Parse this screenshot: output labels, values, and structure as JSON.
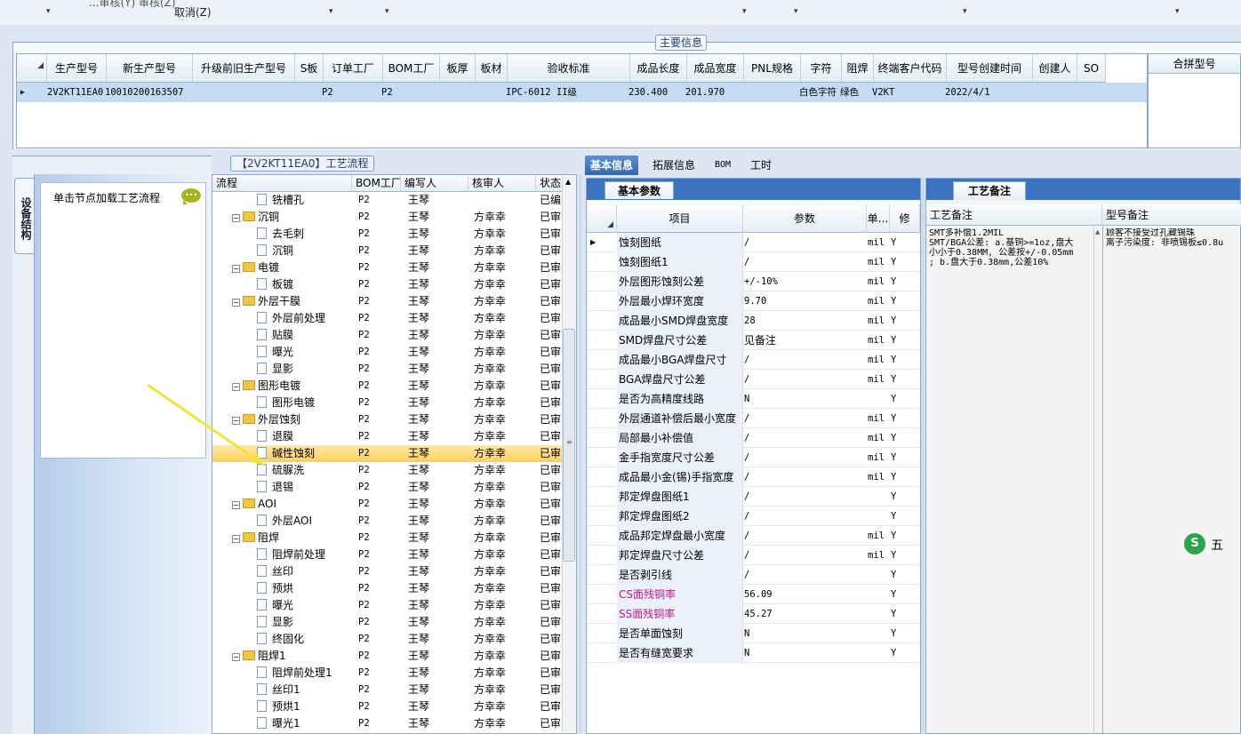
{
  "top": {
    "partial_text": "...审核(Y)   审核(Z)",
    "cancel_label": "取消(Z)"
  },
  "main_info": {
    "title": "主要信息",
    "columns": [
      "生产型号",
      "新生产型号",
      "升级前旧生产型号",
      "S板",
      "订单工厂",
      "BOM工厂",
      "板厚",
      "板材",
      "验收标准",
      "成品长度",
      "成品宽度",
      "PNL规格",
      "字符",
      "阻焊",
      "终端客户代码",
      "型号创建时间",
      "创建人",
      "SO"
    ],
    "row": [
      "2V2KT11EA0",
      "10010200163507",
      "",
      "",
      "P2",
      "P2",
      "",
      "",
      "IPC-6012 II级",
      "230.400",
      "201.970",
      "",
      "白色字符",
      "绿色",
      "V2KT",
      "2022/4/1",
      "",
      ""
    ],
    "merge_header": "合拼型号"
  },
  "left": {
    "side_tab": "设备结构",
    "load_hint": "单击节点加载工艺流程"
  },
  "process": {
    "title": "【2V2KT11EA0】工艺流程",
    "columns": [
      "流程",
      "BOM工厂",
      "编写人",
      "核审人",
      "状态"
    ],
    "rows": [
      {
        "name": "铣槽孔",
        "level": 2,
        "type": "doc",
        "bom": "P2",
        "writer": "王琴",
        "reviewer": "",
        "status": "已编"
      },
      {
        "name": "沉铜",
        "level": 1,
        "type": "folder",
        "bom": "P2",
        "writer": "王琴",
        "reviewer": "方幸幸",
        "status": "已审"
      },
      {
        "name": "去毛刺",
        "level": 2,
        "type": "doc",
        "bom": "P2",
        "writer": "王琴",
        "reviewer": "方幸幸",
        "status": "已审"
      },
      {
        "name": "沉铜",
        "level": 2,
        "type": "doc",
        "bom": "P2",
        "writer": "王琴",
        "reviewer": "方幸幸",
        "status": "已审"
      },
      {
        "name": "电镀",
        "level": 1,
        "type": "folder",
        "bom": "P2",
        "writer": "王琴",
        "reviewer": "方幸幸",
        "status": "已审"
      },
      {
        "name": "板镀",
        "level": 2,
        "type": "doc",
        "bom": "P2",
        "writer": "王琴",
        "reviewer": "方幸幸",
        "status": "已审"
      },
      {
        "name": "外层干膜",
        "level": 1,
        "type": "folder",
        "bom": "P2",
        "writer": "王琴",
        "reviewer": "方幸幸",
        "status": "已审"
      },
      {
        "name": "外层前处理",
        "level": 2,
        "type": "doc",
        "bom": "P2",
        "writer": "王琴",
        "reviewer": "方幸幸",
        "status": "已审"
      },
      {
        "name": "贴膜",
        "level": 2,
        "type": "doc",
        "bom": "P2",
        "writer": "王琴",
        "reviewer": "方幸幸",
        "status": "已审"
      },
      {
        "name": "曝光",
        "level": 2,
        "type": "doc",
        "bom": "P2",
        "writer": "王琴",
        "reviewer": "方幸幸",
        "status": "已审"
      },
      {
        "name": "显影",
        "level": 2,
        "type": "doc",
        "bom": "P2",
        "writer": "王琴",
        "reviewer": "方幸幸",
        "status": "已审"
      },
      {
        "name": "图形电镀",
        "level": 1,
        "type": "folder",
        "bom": "P2",
        "writer": "王琴",
        "reviewer": "方幸幸",
        "status": "已审"
      },
      {
        "name": "图形电镀",
        "level": 2,
        "type": "doc",
        "bom": "P2",
        "writer": "王琴",
        "reviewer": "方幸幸",
        "status": "已审"
      },
      {
        "name": "外层蚀刻",
        "level": 1,
        "type": "folder",
        "bom": "P2",
        "writer": "王琴",
        "reviewer": "方幸幸",
        "status": "已审"
      },
      {
        "name": "退膜",
        "level": 2,
        "type": "doc",
        "bom": "P2",
        "writer": "王琴",
        "reviewer": "方幸幸",
        "status": "已审"
      },
      {
        "name": "碱性蚀刻",
        "level": 2,
        "type": "doc",
        "bom": "P2",
        "writer": "王琴",
        "reviewer": "方幸幸",
        "status": "已审",
        "selected": true
      },
      {
        "name": "硫脲洗",
        "level": 2,
        "type": "doc",
        "bom": "P2",
        "writer": "王琴",
        "reviewer": "方幸幸",
        "status": "已审"
      },
      {
        "name": "退锡",
        "level": 2,
        "type": "doc",
        "bom": "P2",
        "writer": "王琴",
        "reviewer": "方幸幸",
        "status": "已审"
      },
      {
        "name": "AOI",
        "level": 1,
        "type": "folder",
        "bom": "P2",
        "writer": "王琴",
        "reviewer": "方幸幸",
        "status": "已审"
      },
      {
        "name": "外层AOI",
        "level": 2,
        "type": "doc",
        "bom": "P2",
        "writer": "王琴",
        "reviewer": "方幸幸",
        "status": "已审"
      },
      {
        "name": "阻焊",
        "level": 1,
        "type": "folder",
        "bom": "P2",
        "writer": "王琴",
        "reviewer": "方幸幸",
        "status": "已审"
      },
      {
        "name": "阻焊前处理",
        "level": 2,
        "type": "doc",
        "bom": "P2",
        "writer": "王琴",
        "reviewer": "方幸幸",
        "status": "已审"
      },
      {
        "name": "丝印",
        "level": 2,
        "type": "doc",
        "bom": "P2",
        "writer": "王琴",
        "reviewer": "方幸幸",
        "status": "已审"
      },
      {
        "name": "预烘",
        "level": 2,
        "type": "doc",
        "bom": "P2",
        "writer": "王琴",
        "reviewer": "方幸幸",
        "status": "已审"
      },
      {
        "name": "曝光",
        "level": 2,
        "type": "doc",
        "bom": "P2",
        "writer": "王琴",
        "reviewer": "方幸幸",
        "status": "已审"
      },
      {
        "name": "显影",
        "level": 2,
        "type": "doc",
        "bom": "P2",
        "writer": "王琴",
        "reviewer": "方幸幸",
        "status": "已审"
      },
      {
        "name": "终固化",
        "level": 2,
        "type": "doc",
        "bom": "P2",
        "writer": "王琴",
        "reviewer": "方幸幸",
        "status": "已审"
      },
      {
        "name": "阻焊1",
        "level": 1,
        "type": "folder",
        "bom": "P2",
        "writer": "王琴",
        "reviewer": "方幸幸",
        "status": "已审"
      },
      {
        "name": "阻焊前处理1",
        "level": 2,
        "type": "doc",
        "bom": "P2",
        "writer": "王琴",
        "reviewer": "方幸幸",
        "status": "已审"
      },
      {
        "name": "丝印1",
        "level": 2,
        "type": "doc",
        "bom": "P2",
        "writer": "王琴",
        "reviewer": "方幸幸",
        "status": "已审"
      },
      {
        "name": "预烘1",
        "level": 2,
        "type": "doc",
        "bom": "P2",
        "writer": "王琴",
        "reviewer": "方幸幸",
        "status": "已审"
      },
      {
        "name": "曝光1",
        "level": 2,
        "type": "doc",
        "bom": "P2",
        "writer": "王琴",
        "reviewer": "方幸幸",
        "status": "已审"
      }
    ]
  },
  "tabs": [
    {
      "label": "基本信息",
      "active": true
    },
    {
      "label": "拓展信息"
    },
    {
      "label": "BOM"
    },
    {
      "label": "工时"
    }
  ],
  "basic": {
    "title": "基本参数",
    "columns": [
      "项目",
      "参数",
      "单...",
      "修"
    ],
    "rows": [
      {
        "item": "蚀刻图纸",
        "param": "/",
        "unit": "mil",
        "mod": "Y"
      },
      {
        "item": "蚀刻图纸1",
        "param": "/",
        "unit": "mil",
        "mod": "Y"
      },
      {
        "item": "外层图形蚀刻公差",
        "param": "+/-10%",
        "unit": "mil",
        "mod": "Y"
      },
      {
        "item": "外层最小焊环宽度",
        "param": "9.70",
        "unit": "mil",
        "mod": "Y"
      },
      {
        "item": "成品最小SMD焊盘宽度",
        "param": "28",
        "unit": "mil",
        "mod": "Y"
      },
      {
        "item": "SMD焊盘尺寸公差",
        "param": "见备注",
        "unit": "mil",
        "mod": "Y"
      },
      {
        "item": "成品最小BGA焊盘尺寸",
        "param": "/",
        "unit": "mil",
        "mod": "Y"
      },
      {
        "item": "BGA焊盘尺寸公差",
        "param": "/",
        "unit": "mil",
        "mod": "Y"
      },
      {
        "item": "是否为高精度线路",
        "param": "N",
        "unit": "",
        "mod": "Y"
      },
      {
        "item": "外层通道补偿后最小宽度",
        "param": "/",
        "unit": "mil",
        "mod": "Y"
      },
      {
        "item": "局部最小补偿值",
        "param": "/",
        "unit": "mil",
        "mod": "Y"
      },
      {
        "item": "金手指宽度尺寸公差",
        "param": "/",
        "unit": "mil",
        "mod": "Y"
      },
      {
        "item": "成品最小金(锡)手指宽度",
        "param": "/",
        "unit": "mil",
        "mod": "Y"
      },
      {
        "item": "邦定焊盘图纸1",
        "param": "/",
        "unit": "",
        "mod": "Y"
      },
      {
        "item": "邦定焊盘图纸2",
        "param": "/",
        "unit": "",
        "mod": "Y"
      },
      {
        "item": "成品邦定焊盘最小宽度",
        "param": "/",
        "unit": "mil",
        "mod": "Y"
      },
      {
        "item": "邦定焊盘尺寸公差",
        "param": "/",
        "unit": "mil",
        "mod": "Y"
      },
      {
        "item": "是否剥引线",
        "param": "/",
        "unit": "",
        "mod": "Y"
      },
      {
        "item": "CS面残铜率",
        "param": "56.09",
        "unit": "",
        "mod": "Y",
        "pink": true
      },
      {
        "item": "SS面残铜率",
        "param": "45.27",
        "unit": "",
        "mod": "Y",
        "pink": true
      },
      {
        "item": "是否单面蚀刻",
        "param": "N",
        "unit": "",
        "mod": "Y"
      },
      {
        "item": "是否有缝宽要求",
        "param": "N",
        "unit": "",
        "mod": "Y"
      }
    ]
  },
  "notes": {
    "title": "工艺备注",
    "col1": "工艺备注",
    "col2": "型号备注",
    "text1": "SMT多补偿1.2MIL\nSMT/BGA公差: a.基铜>=1oz,盘大\n小小于0.38MM, 公差按+/-0.05mm\n; b.盘大于0.38mm,公差10%",
    "text2": "顾客不接受过孔藏锡珠\n离子污染度: 非喷锡板≤0.8u"
  },
  "ime": {
    "logo": "S",
    "label": "五"
  },
  "colors": {
    "accent": "#3b73c0",
    "selection": "#ffcf5c",
    "row_highlight": "#c4dcf3",
    "pink": "#c0188a"
  }
}
